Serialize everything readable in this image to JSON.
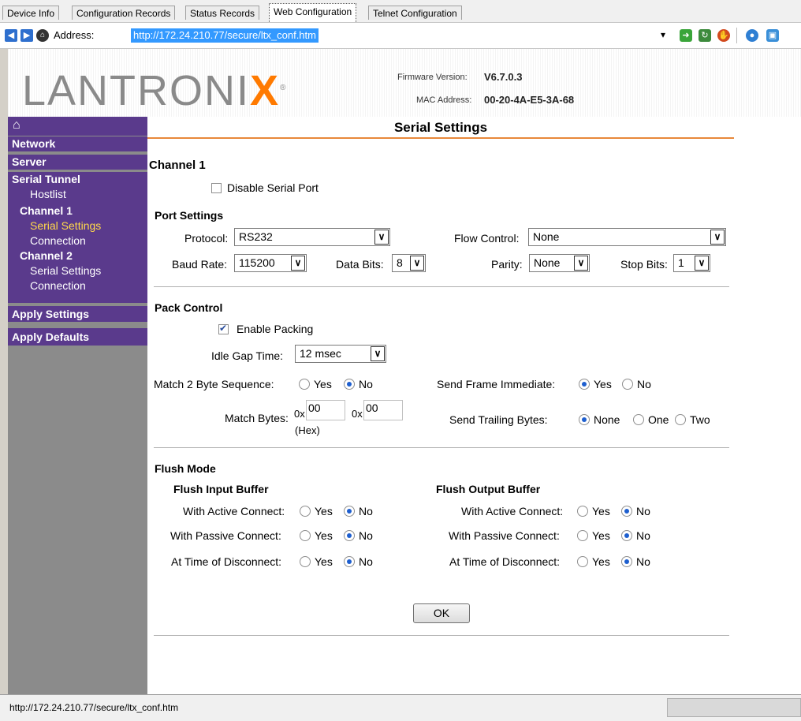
{
  "tabs": [
    "Device Info",
    "Configuration Records",
    "Status Records",
    "Web Configuration",
    "Telnet Configuration"
  ],
  "address": {
    "label": "Address:",
    "url": "http://172.24.210.77/secure/ltx_conf.htm"
  },
  "banner": {
    "logo_text": "LANTRONI",
    "logo_x": "X",
    "logo_reg": "®",
    "fw_label": "Firmware Version:",
    "fw_value": "V6.7.0.3",
    "mac_label": "MAC Address:",
    "mac_value": "00-20-4A-E5-3A-68"
  },
  "sidebar": {
    "home_icon": "home-icon",
    "network": "Network",
    "server": "Server",
    "serial_tunnel": "Serial Tunnel",
    "hostlist": "Hostlist",
    "channel1": "Channel 1",
    "ch1_serial": "Serial Settings",
    "ch1_conn": "Connection",
    "channel2": "Channel 2",
    "ch2_serial": "Serial Settings",
    "ch2_conn": "Connection",
    "apply_settings": "Apply Settings",
    "apply_defaults": "Apply Defaults"
  },
  "page": {
    "title": "Serial Settings",
    "channel": "Channel 1",
    "disable_port": "Disable Serial Port",
    "port_settings": "Port Settings",
    "protocol_label": "Protocol:",
    "protocol_value": "RS232",
    "flow_label": "Flow Control:",
    "flow_value": "None",
    "baud_label": "Baud Rate:",
    "baud_value": "115200",
    "databits_label": "Data Bits:",
    "databits_value": "8",
    "parity_label": "Parity:",
    "parity_value": "None",
    "stopbits_label": "Stop Bits:",
    "stopbits_value": "1",
    "pack_control": "Pack Control",
    "enable_packing": "Enable Packing",
    "idle_label": "Idle Gap Time:",
    "idle_value": "12 msec",
    "match2_label": "Match 2 Byte Sequence:",
    "send_frame_label": "Send Frame Immediate:",
    "match_bytes_label": "Match Bytes:",
    "hex_prefix": "0x",
    "match_byte1": "00",
    "match_byte2": "00",
    "hex_note": "(Hex)",
    "trailing_label": "Send Trailing Bytes:",
    "yes": "Yes",
    "no": "No",
    "none": "None",
    "one": "One",
    "two": "Two",
    "flush_mode": "Flush Mode",
    "flush_input": "Flush Input Buffer",
    "flush_output": "Flush Output Buffer",
    "active_connect": "With Active Connect:",
    "passive_connect": "With Passive Connect:",
    "disconnect": "At Time of Disconnect:",
    "ok": "OK"
  },
  "status": {
    "text": "http://172.24.210.77/secure/ltx_conf.htm"
  }
}
